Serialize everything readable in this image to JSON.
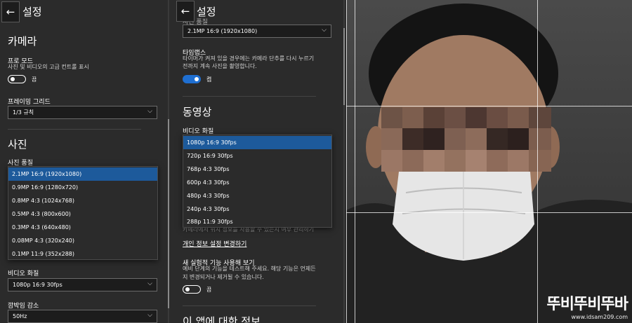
{
  "panel1": {
    "back_glyph": "←",
    "title": "설정",
    "camera_heading": "카메라",
    "pro_mode": {
      "label": "프로 모드",
      "desc": "사진 및 비디오의 고급 컨트롤 표시",
      "toggle_text": "끔",
      "on": false
    },
    "framing_grid": {
      "label": "프레이밍 그리드",
      "value": "1/3 규칙"
    },
    "photo_heading": "사진",
    "photo_quality": {
      "label": "사진 품질",
      "options": [
        "2.1MP 16:9 (1920x1080)",
        "0.9MP 16:9 (1280x720)",
        "0.8MP 4:3 (1024x768)",
        "0.5MP 4:3 (800x600)",
        "0.3MP 4:3 (640x480)",
        "0.08MP 4:3 (320x240)",
        "0.1MP 11:9 (352x288)"
      ],
      "selected_index": 0
    },
    "video_quality": {
      "label": "비디오 화질",
      "value": "1080p 16:9 30fps"
    },
    "flicker": {
      "label": "깜박임 감소",
      "value": "50Hz"
    }
  },
  "panel2": {
    "back_glyph": "←",
    "title": "설정",
    "top_cut_label": "사진 품질",
    "top_select_value": "2.1MP 16:9 (1920x1080)",
    "timelapse": {
      "label": "타임랩스",
      "desc_line1": "타이머가 켜져 있을 경우에는 카메라 단추를 다시 누르기",
      "desc_line2": "전까지 계속 사진을 촬영합니다.",
      "toggle_text": "켬",
      "on": true
    },
    "video_heading": "동영상",
    "video_quality": {
      "label": "비디오 화질",
      "options": [
        "1080p 16:9 30fps",
        "720p 16:9 30fps",
        "768p 4:3 30fps",
        "600p 4:3 30fps",
        "480p 4:3 30fps",
        "240p 4:3 30fps",
        "288p 11:9 30fps"
      ],
      "selected_index": 0
    },
    "hidden_text": "카메라에서 위치 정보를 사용할 수 있는지 여부 관리하기",
    "privacy_link": "개인 정보 설정 변경하기",
    "experimental": {
      "label": "새 실험적 기능 사용해 보기",
      "desc_line1": "예비 단계의 기능을 테스트해 주세요. 해당 기능은 언제든",
      "desc_line2": "지 변경되거나 제거될 수 있습니다.",
      "toggle_text": "끔",
      "on": false
    },
    "about_heading": "이 앱에 대한 정보"
  },
  "watermark": {
    "main": "뚜비뚜비뚜바",
    "sub": "www.idsam209.com"
  },
  "colors": {
    "accent": "#1f6fd1",
    "selected_item": "#1d5a9b",
    "panel_bg": "#2b2b2b"
  }
}
